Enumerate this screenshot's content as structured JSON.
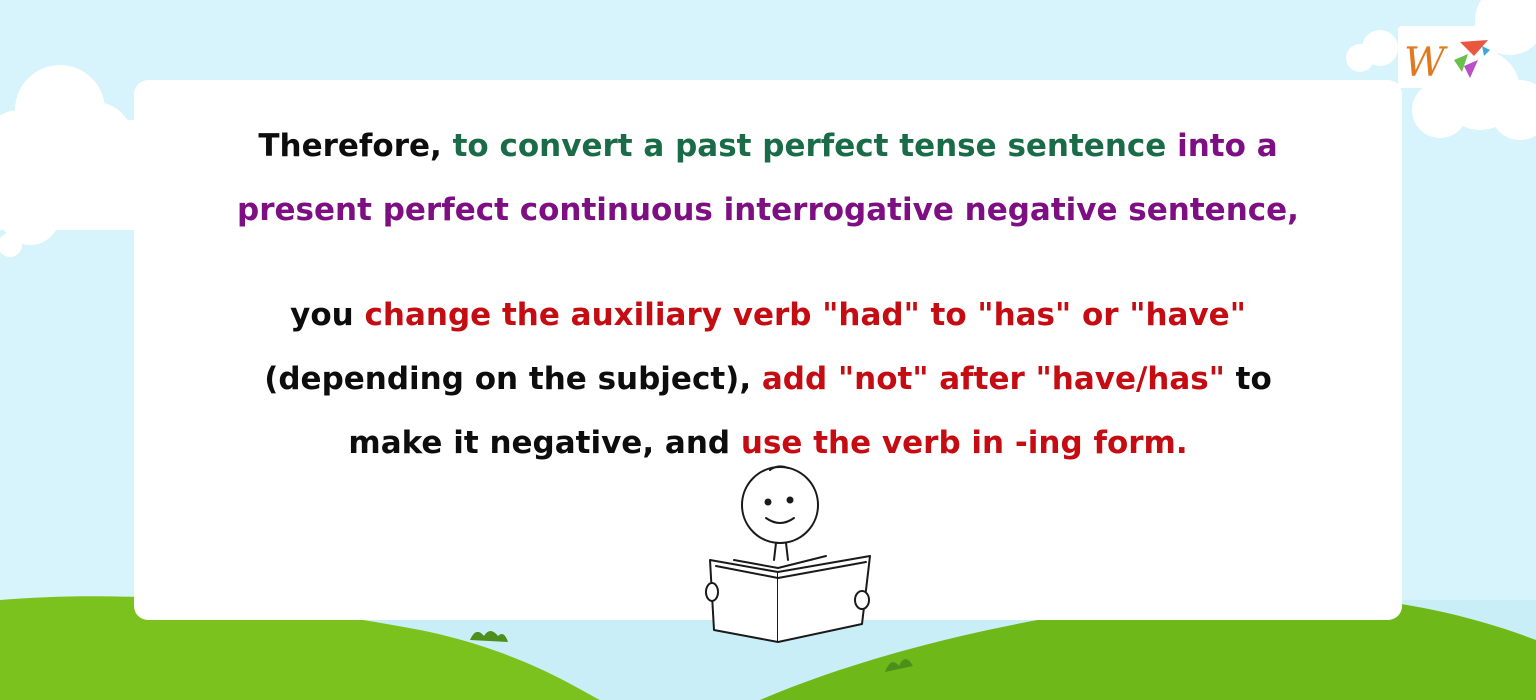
{
  "paragraph1": {
    "line1": {
      "part1": "Therefore, ",
      "part2": "to convert a past perfect tense sentence",
      "part3": " into a"
    },
    "line2": {
      "part1": "present perfect continuous interrogative negative sentence,"
    }
  },
  "paragraph2": {
    "line1": {
      "part1": "you ",
      "part2": "change the auxiliary verb \"had\" to \"has\" or \"have\""
    },
    "line2": {
      "part1": "(depending on the subject), ",
      "part2": "add \"not\" after \"have/has\"",
      "part3": " to"
    },
    "line3": {
      "part1": "make it negative, and ",
      "part2": "use the verb in -ing form."
    }
  },
  "colors": {
    "black": "#0d0d0d",
    "green": "#1a6b47",
    "purple": "#7d0f82",
    "red": "#c40c12",
    "sky": "#d7f3fb",
    "grass": "#7cc21e"
  },
  "logo": {
    "icon": "logo-icon"
  },
  "illustration": {
    "icon": "stick-figure-reading-book-icon"
  }
}
